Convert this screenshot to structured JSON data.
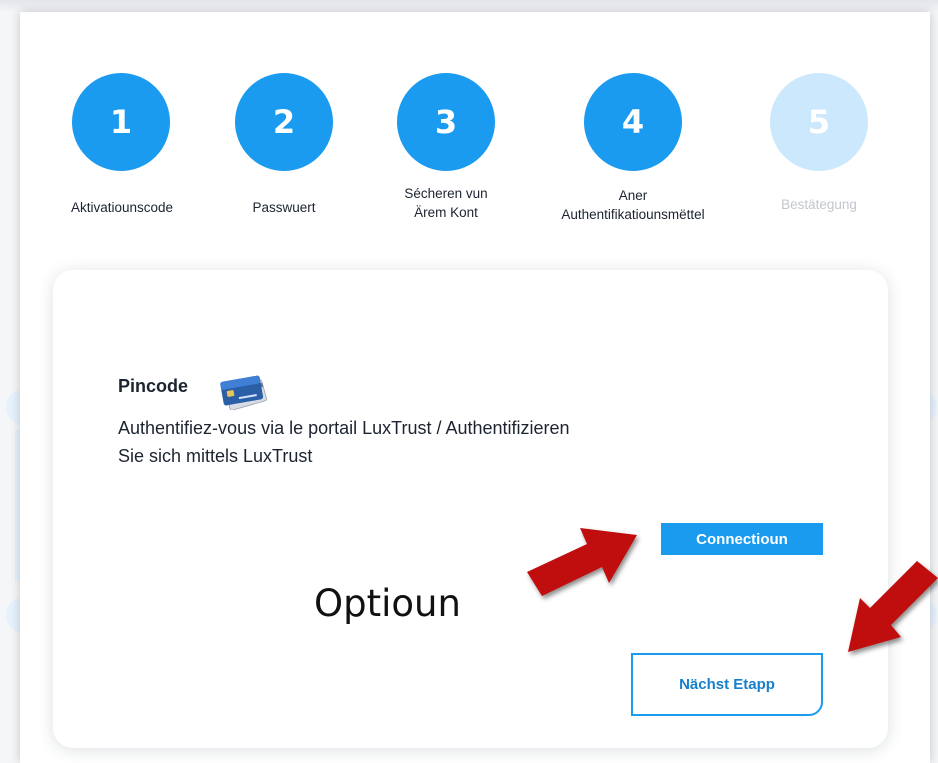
{
  "stepper": {
    "steps": [
      {
        "number": "1",
        "label_lines": [
          "Aktivatiounscode"
        ],
        "state": "active"
      },
      {
        "number": "2",
        "label_lines": [
          "Passwuert"
        ],
        "state": "active"
      },
      {
        "number": "3",
        "label_lines": [
          "Sécheren vun",
          "Ärem Kont"
        ],
        "state": "active"
      },
      {
        "number": "4",
        "label_lines": [
          "Aner",
          "Authentifikatiounsmëttel"
        ],
        "state": "active"
      },
      {
        "number": "5",
        "label_lines": [
          "Bestätegung"
        ],
        "state": "inactive"
      }
    ]
  },
  "card": {
    "title": "Pincode",
    "title_icon": "credit-card-icon",
    "description_lines": [
      "Authentifiez-vous via le portail LuxTrust / Authentifizieren",
      "Sie sich mittels LuxTrust"
    ],
    "connect_button_label": "Connectioun",
    "next_button_label": "Nächst Etapp"
  },
  "annotation": {
    "option_label": "Optioun",
    "arrow_icon": "red-arrow-icon"
  },
  "colors": {
    "accent": "#1a9bf0",
    "accent_inactive": "#cce8fc",
    "arrow": "#c00f0f",
    "text": "#1c2430",
    "inactive_text": "#c3c7cd"
  }
}
